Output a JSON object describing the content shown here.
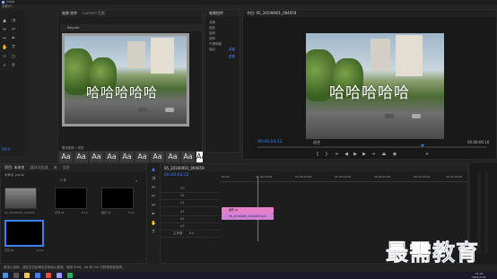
{
  "app": {
    "title": "Adob",
    "menu": "文件(F)"
  },
  "source_tabs": [
    "效果 控件",
    "Lumetri 范围",
    "源: (无剪辑)",
    "音频剪辑混合器"
  ],
  "effects_panel": {
    "title": "效果控件",
    "items": [
      "变换",
      "缩放",
      "旋转",
      "倾斜",
      "不透明度",
      "锚点"
    ],
    "value_label": "缩放",
    "link_a": "重置",
    "link_b": "重置"
  },
  "essential_graphics": {
    "title": "文本",
    "label": "Regular",
    "caption": "哈哈哈哈哈",
    "style_label": "基本图形 / 浏览"
  },
  "program_monitor": {
    "title": "节目: 95_20190901_094659",
    "timecode": "00:00:03:12",
    "fit": "适合",
    "duration": "00:00:06:16",
    "caption": "哈哈哈哈哈"
  },
  "left_timecode": "00:0:",
  "aa_label": "Aa",
  "project_panel": {
    "tabs": [
      "项目: 未命名",
      "媒体浏览器",
      "库",
      "信息"
    ],
    "path": "未命名.prproj",
    "count": "3 项",
    "items": [
      {
        "name": "95_20190901_094659",
        "dur": "6:16"
      },
      {
        "name": "序列 01",
        "dur": "6:16"
      },
      {
        "name": "图形 01",
        "dur": "5:00"
      },
      {
        "name": "序列 01",
        "dur": "6:16"
      }
    ]
  },
  "timeline": {
    "tab": "95_20190901_094659",
    "timecode": "00:00:03:12",
    "ruler": [
      "00:00",
      "00:00:05:00",
      "00:00:10:00",
      "00:00:15:00",
      "00:00:20:00",
      "00:00:25:00",
      "00:00:30:00"
    ],
    "tracks_video": [
      "V3",
      "V2",
      "V1"
    ],
    "tracks_audio": [
      "A1",
      "A2",
      "A3"
    ],
    "master": "主声道",
    "master_val": "0.0",
    "clip_graphic": "图形 01",
    "clip_video": "95_20190901_094659.mp4"
  },
  "status_text": "单击以选择，或在空白处单击并拖动以框选。使用 Shift、Alt 和 Ctrl 可获得其他选项。",
  "watermark": "最需教育",
  "clock": {
    "time": "11:21",
    "date": "2021/7/12"
  },
  "colors": {
    "accent": "#3c82f6",
    "playhead": "#3c82f6",
    "clip_pink": "#e680c8",
    "clip_video": "#d080d8"
  }
}
